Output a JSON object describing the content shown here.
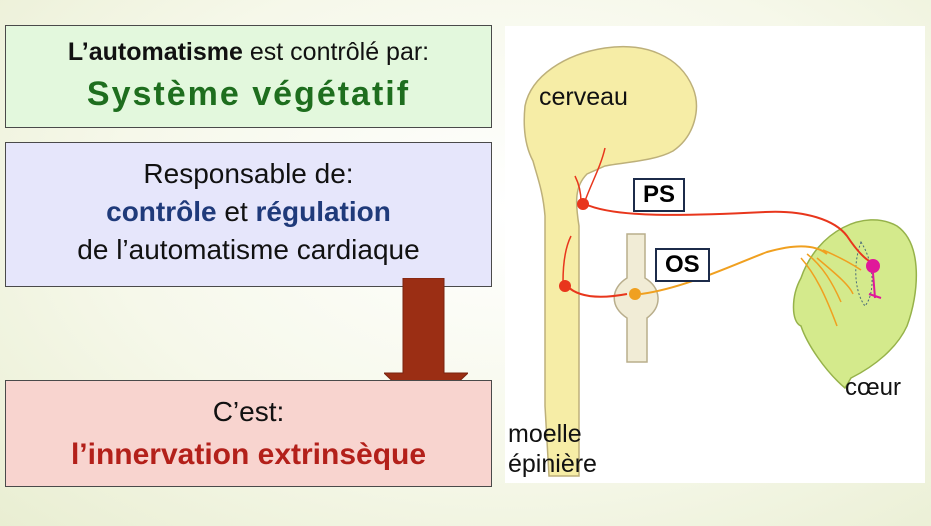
{
  "box1": {
    "bold": "L’automatisme",
    "rest": " est contrôlé par:",
    "title": "Système végétatif"
  },
  "box2": {
    "line1": "Responsable de:",
    "w1": "contrôle",
    "mid": " et ",
    "w2": "régulation",
    "line3": "de l’automatisme cardiaque"
  },
  "box3": {
    "line1": "C’est:",
    "line2": "l’innervation extrinsèque"
  },
  "diagram": {
    "cerveau": "cerveau",
    "coeur": "cœur",
    "moelle1": "moelle",
    "moelle2": "épinière",
    "ps": "PS",
    "os": "OS"
  },
  "colors": {
    "green_title": "#1e6e1e",
    "navy": "#1f3a7a",
    "red_text": "#b3201a",
    "arrow": "#9b2e14",
    "parasympathetic": "#e8361c",
    "orthosympathetic": "#f0a020",
    "heart": "#d4ea8c",
    "nerve_tissue": "#f6eda6",
    "sinus_node": "#e0189a"
  }
}
